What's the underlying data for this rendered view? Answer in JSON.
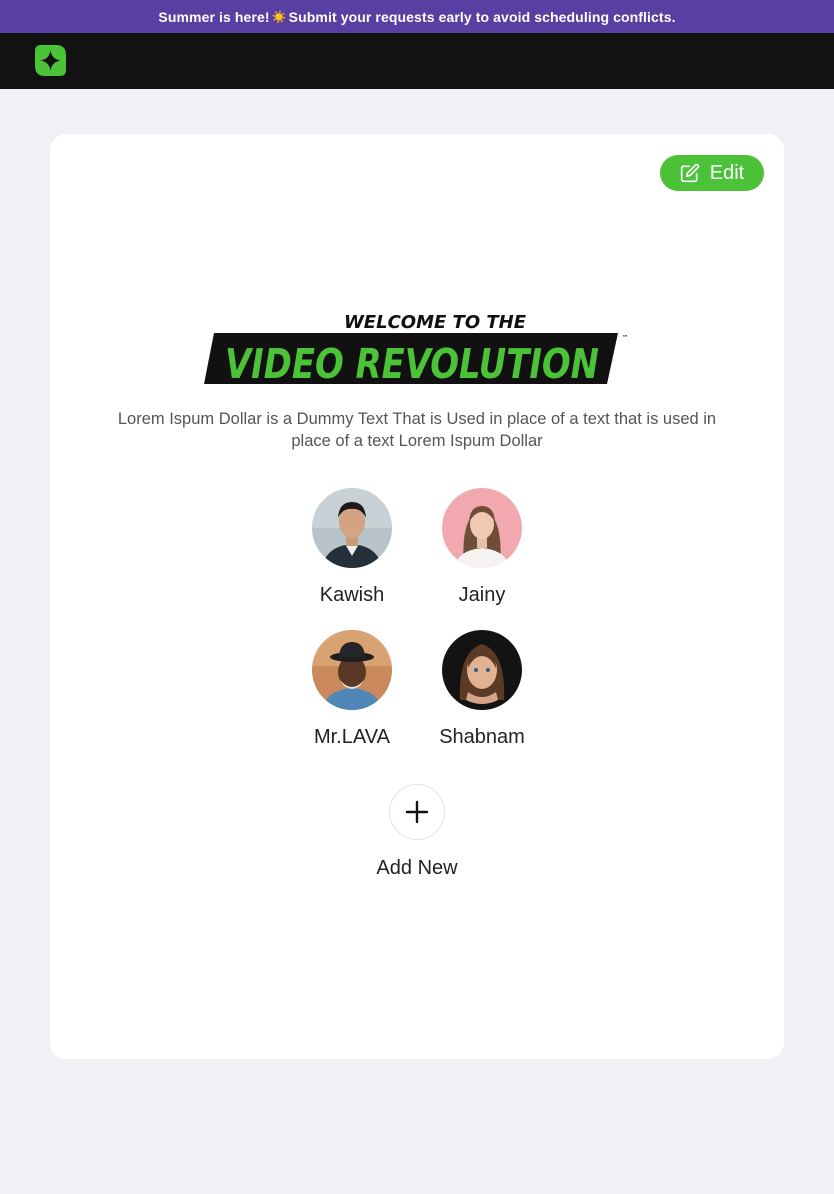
{
  "announcement": {
    "text_before": "Summer is here!",
    "emoji": "☀️",
    "text_after": "Submit your requests early to avoid scheduling conflicts."
  },
  "header": {
    "logo_icon": "sparkle-logo-icon"
  },
  "card": {
    "edit_label": "Edit",
    "edit_icon": "edit-icon",
    "hero_line1": "WELCOME TO THE",
    "hero_line2": "VIDEO REVOLUTION",
    "hero_tm": "™",
    "description": "Lorem Ispum Dollar is a Dummy Text That is Used in place of a text that is used in place of a text Lorem Ispum Dollar"
  },
  "profiles": [
    {
      "name": "Kawish"
    },
    {
      "name": "Jainy"
    },
    {
      "name": "Mr.LAVA"
    },
    {
      "name": "Shabnam"
    }
  ],
  "add_new": {
    "label": "Add New",
    "icon": "plus-icon"
  },
  "colors": {
    "announcement_bg": "#5a3fa3",
    "nav_bg": "#121212",
    "accent_green": "#4bc238",
    "page_bg": "#f1f1f5"
  }
}
